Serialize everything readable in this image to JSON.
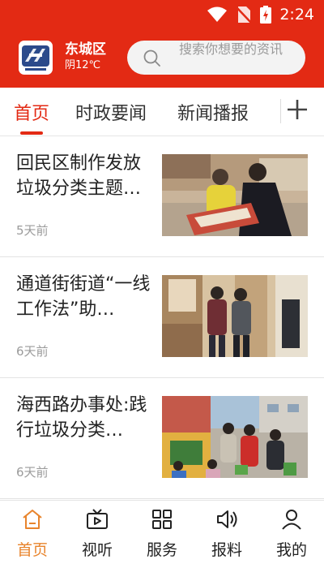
{
  "status_bar": {
    "time": "2:24",
    "icons": [
      "wifi-icon",
      "no-sim-icon",
      "battery-icon"
    ]
  },
  "header": {
    "location": "东城区",
    "weather": "阴12℃",
    "search_placeholder": "搜索你想要的资讯"
  },
  "tabs": [
    {
      "label": "首页",
      "active": true
    },
    {
      "label": "时政要闻",
      "active": false
    },
    {
      "label": "新闻播报",
      "active": false
    },
    {
      "label": "",
      "active": false
    }
  ],
  "news": [
    {
      "title": "回民区制作发放垃圾分类主题…",
      "time": "5天前"
    },
    {
      "title": "通道街街道“一线工作法”助…",
      "time": "6天前"
    },
    {
      "title": "海西路办事处:践行垃圾分类…",
      "time": "6天前"
    }
  ],
  "bottom_nav": [
    {
      "label": "首页",
      "icon": "home-icon",
      "active": true
    },
    {
      "label": "视听",
      "icon": "video-icon",
      "active": false
    },
    {
      "label": "服务",
      "icon": "grid-icon",
      "active": false
    },
    {
      "label": "报料",
      "icon": "speaker-icon",
      "active": false
    },
    {
      "label": "我的",
      "icon": "user-icon",
      "active": false
    }
  ],
  "colors": {
    "brand_red": "#e32a14",
    "active_orange": "#e8842c"
  }
}
